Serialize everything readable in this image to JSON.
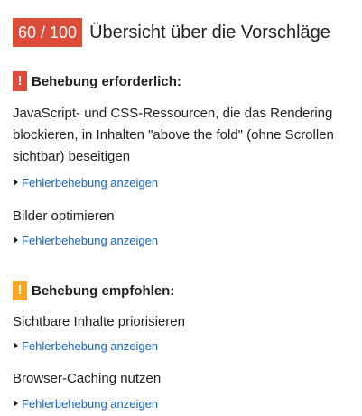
{
  "header": {
    "score": "60 / 100",
    "title": "Übersicht über die Vorschläge"
  },
  "sections": [
    {
      "badge": "!",
      "title": "Behebung erforderlich:",
      "rules": [
        {
          "title": "JavaScript- und CSS-Ressourcen, die das Rendering blockieren, in Inhalten \"above the fold\" (ohne Scrollen sichtbar) beseitigen",
          "link": "Fehlerbehebung anzeigen"
        },
        {
          "title": "Bilder optimieren",
          "link": "Fehlerbehebung anzeigen"
        }
      ]
    },
    {
      "badge": "!",
      "title": "Behebung empfohlen:",
      "rules": [
        {
          "title": "Sichtbare Inhalte priorisieren",
          "link": "Fehlerbehebung anzeigen"
        },
        {
          "title": "Browser-Caching nutzen",
          "link": "Fehlerbehebung anzeigen"
        }
      ]
    }
  ],
  "colors": {
    "error": "#dd4b39",
    "warning": "#f9a825",
    "link": "#1565c0"
  }
}
